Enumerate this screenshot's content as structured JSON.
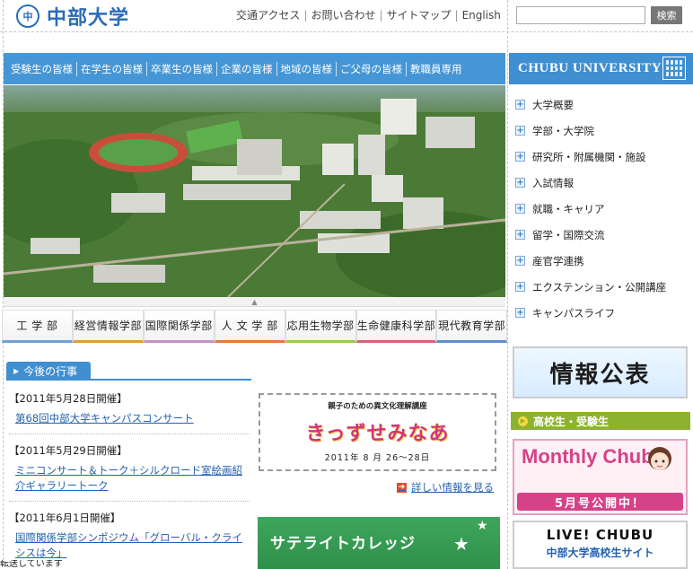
{
  "header": {
    "logo_emblem": "中",
    "logo_text": "中部大学",
    "top_links": [
      "交通アクセス",
      "お問い合わせ",
      "サイトマップ",
      "English"
    ],
    "search_button": "検索",
    "search_placeholder": ""
  },
  "nav": {
    "items": [
      "受験生の皆様",
      "在学生の皆様",
      "卒業生の皆様",
      "企業の皆様",
      "地域の皆様",
      "ご父母の皆様",
      "教職員専用"
    ]
  },
  "brand": {
    "text": "CHUBU UNIVERSITY"
  },
  "departments": [
    "工 学 部",
    "経営情報学部",
    "国際関係学部",
    "人 文 学 部",
    "応用生物学部",
    "生命健康科学部",
    "現代教育学部"
  ],
  "department_colors": [
    "#6fa0d8",
    "#e59a3a",
    "#c890c4",
    "#e27a3a",
    "#9cc75a",
    "#d6617a",
    "#5b8fd1"
  ],
  "side_menu": [
    "大学概要",
    "学部・大学院",
    "研究所・附属機関・施設",
    "入試情報",
    "就職・キャリア",
    "留学・国際交流",
    "産官学連携",
    "エクステンション・公開講座",
    "キャンパスライフ"
  ],
  "events": {
    "header": "今後の行事",
    "items": [
      {
        "date": "【2011年5月28日開催】",
        "title": "第68回中部大学キャンパスコンサート"
      },
      {
        "date": "【2011年5月29日開催】",
        "title": "ミニコンサート＆トーク＋シルクロード室絵画紹介ギャラリートーク"
      },
      {
        "date": "【2011年6月1日開催】",
        "title": "国際関係学部シンポジウム「グローバル・クライシスは今」"
      }
    ]
  },
  "promo": {
    "subtitle": "親子のための異文化理解講座",
    "title": "きっずせみなあ",
    "date": "2011年 8 月 26〜28日",
    "more_link": "詳しい情報を見る"
  },
  "satellite": {
    "title": "サテライトカレッジ"
  },
  "right_panel": {
    "jouhou": "情報公表",
    "hs_header": "高校生・受験生",
    "monthly_title": "Monthly Chubu",
    "monthly_issue": "5月号公開中！",
    "live_title": "LIVE! CHUBU",
    "live_sub": "中部大学高校生サイト"
  },
  "status_bar": "転送しています"
}
